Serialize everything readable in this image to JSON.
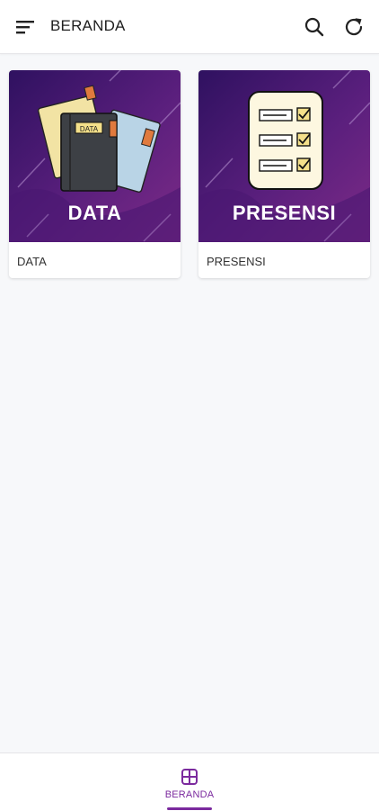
{
  "header": {
    "title": "BERANDA",
    "menu_icon": "menu-sort-icon",
    "search_icon": "search-icon",
    "refresh_icon": "refresh-icon"
  },
  "cards": [
    {
      "banner_text": "DATA",
      "caption": "DATA",
      "illustration": "books-folders-illustration"
    },
    {
      "banner_text": "PRESENSI",
      "caption": "PRESENSI",
      "illustration": "checklist-clipboard-illustration"
    }
  ],
  "bottom_nav": {
    "items": [
      {
        "label": "BERANDA",
        "icon": "grid-icon",
        "active": true
      }
    ]
  },
  "colors": {
    "accent": "#7b2a9e",
    "banner_dark": "#3b1466",
    "banner_light": "#7b2a8c"
  }
}
